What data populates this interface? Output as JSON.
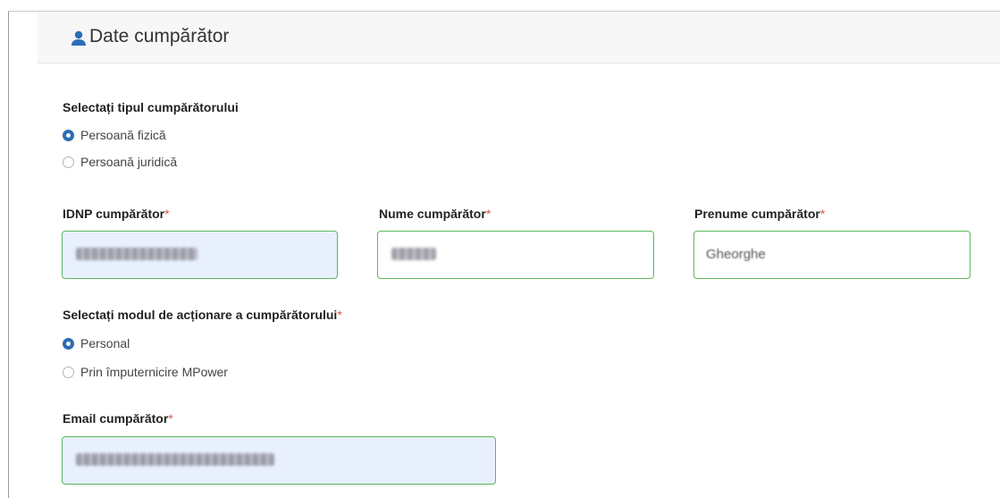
{
  "header": {
    "title": "Date cumpărător",
    "icon": "user-icon"
  },
  "buyer_type": {
    "label": "Selectați tipul cumpărătorului",
    "options": [
      {
        "label": "Persoană fizică",
        "checked": true
      },
      {
        "label": "Persoană juridică",
        "checked": false
      }
    ]
  },
  "fields": {
    "idnp": {
      "label": "IDNP cumpărător",
      "required_mark": "*"
    },
    "nume": {
      "label": "Nume cumpărător",
      "required_mark": "*"
    },
    "prenume": {
      "label": "Prenume cumpărător",
      "required_mark": "*",
      "value": "Gheorghe"
    },
    "email": {
      "label": "Email cumpărător",
      "required_mark": "*"
    }
  },
  "action_mode": {
    "label": "Selectați modul de acționare a cumpărătorului",
    "required_mark": "*",
    "options": [
      {
        "label": "Personal",
        "checked": true
      },
      {
        "label": "Prin împuternicire MPower",
        "checked": false
      }
    ]
  },
  "colors": {
    "accent": "#2b6db5",
    "field_border": "#5cb85c",
    "autofill_bg": "#e8f0fe",
    "required": "#d9534f"
  }
}
